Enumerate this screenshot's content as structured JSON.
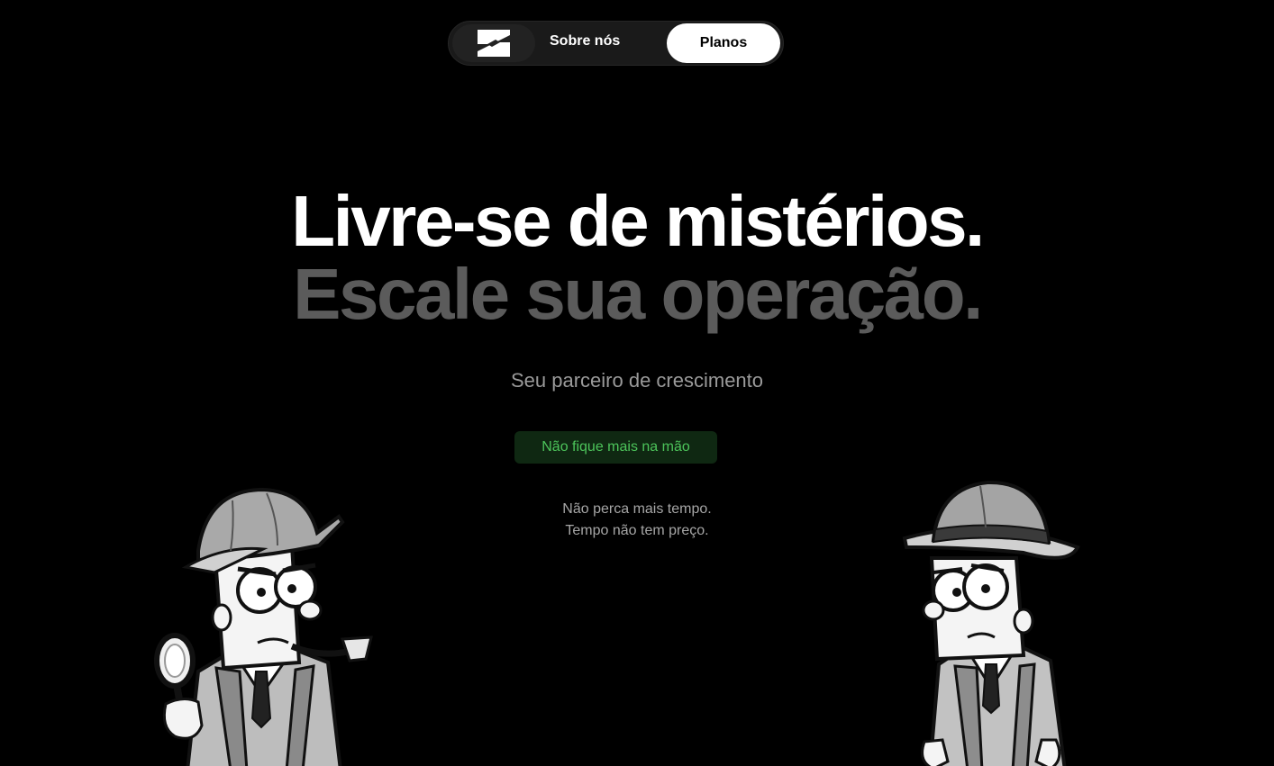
{
  "nav": {
    "logo_icon": "brand-z-logo-icon",
    "about_label": "Sobre nós",
    "plans_label": "Planos"
  },
  "hero": {
    "headline_line1": "Livre-se de mistérios.",
    "headline_line2": "Escale sua operação.",
    "subtitle": "Seu parceiro de crescimento",
    "cta_label": "Não fique mais na mão",
    "note_line1": "Não perca mais tempo.",
    "note_line2": "Tempo não tem preço."
  },
  "illustrations": {
    "left": "detective-with-magnifying-glass-and-pipe",
    "right": "detective-in-fedora"
  },
  "colors": {
    "background": "#000000",
    "headline_primary": "#ffffff",
    "headline_secondary": "#5b5b5b",
    "cta_background": "#0f2812",
    "cta_text": "#4cc35a"
  }
}
